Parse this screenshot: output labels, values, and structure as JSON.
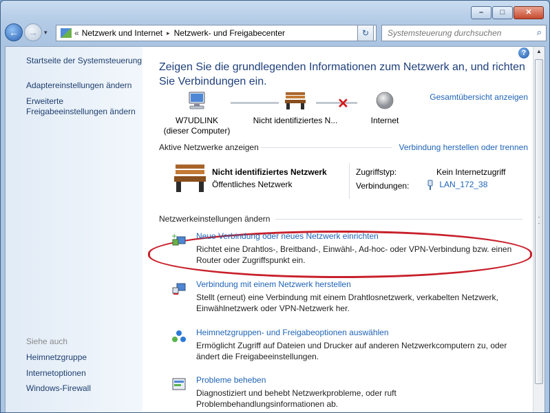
{
  "window": {
    "minimize_glyph": "–",
    "maximize_glyph": "□",
    "close_glyph": "✕"
  },
  "nav": {
    "back_arrow": "←",
    "forward_arrow": "→",
    "history_drop": "▾",
    "overflow": "«",
    "breadcrumbs": [
      "Netzwerk und Internet",
      "Netzwerk- und Freigabecenter"
    ],
    "separator": "▸",
    "address_drop": "▼",
    "refresh_glyph": "↻",
    "search_placeholder": "Systemsteuerung durchsuchen",
    "search_icon_glyph": "⌕"
  },
  "sidebar": {
    "home": "Startseite der Systemsteuerung",
    "adapter": "Adaptereinstellungen ändern",
    "sharing_line1": "Erweiterte",
    "sharing_line2": "Freigabeeinstellungen ändern",
    "see_also": "Siehe auch",
    "links": [
      "Heimnetzgruppe",
      "Internetoptionen",
      "Windows-Firewall"
    ]
  },
  "main": {
    "help": "?",
    "heading": "Zeigen Sie die grundlegenden Informationen zum Netzwerk an, und richten Sie Verbindungen ein.",
    "full_map": "Gesamtübersicht anzeigen",
    "map": {
      "computer_name": "W7UDLINK",
      "computer_sub": "(dieser Computer)",
      "network": "Nicht identifiziertes N...",
      "internet": "Internet"
    },
    "active_header": "Aktive Netzwerke anzeigen",
    "connect_link": "Verbindung herstellen oder trennen",
    "active": {
      "name": "Nicht identifiziertes Netzwerk",
      "type": "Öffentliches Netzwerk",
      "access_label": "Zugriffstyp:",
      "access_value": "Kein Internetzugriff",
      "connections_label": "Verbindungen:",
      "connections_value": "LAN_172_38"
    },
    "settings_header": "Netzwerkeinstellungen ändern",
    "tasks": [
      {
        "title": "Neue Verbindung oder neues Netzwerk einrichten",
        "desc": "Richtet eine Drahtlos-, Breitband-, Einwähl-, Ad-hoc- oder VPN-Verbindung bzw. einen Router oder Zugriffspunkt ein."
      },
      {
        "title": "Verbindung mit einem Netzwerk herstellen",
        "desc": "Stellt (erneut) eine Verbindung mit einem Drahtlosnetzwerk, verkabelten Netzwerk, Einwählnetzwerk oder VPN-Netzwerk her."
      },
      {
        "title": "Heimnetzgruppen- und Freigabeoptionen auswählen",
        "desc": "Ermöglicht Zugriff auf Dateien und Drucker auf anderen Netzwerkcomputern zu, oder ändert die Freigabeeinstellungen."
      },
      {
        "title": "Probleme beheben",
        "desc": "Diagnostiziert und behebt Netzwerkprobleme, oder ruft Problembehandlungsinformationen ab."
      }
    ]
  },
  "colors": {
    "link": "#1e63b6",
    "heading": "#1e3f7a",
    "highlight": "#c8202b",
    "disconnected": "#d21b1b"
  }
}
